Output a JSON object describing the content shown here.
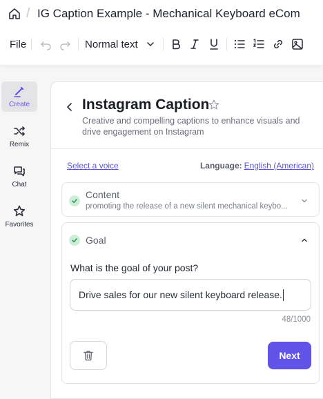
{
  "header": {
    "doc_title": "IG Caption Example - Mechanical Keyboard eCom",
    "home_icon": "home-icon"
  },
  "toolbar": {
    "file_label": "File",
    "text_style": "Normal text",
    "icons": [
      "undo-icon",
      "redo-icon",
      "chevron-down-icon",
      "bold-icon",
      "italic-icon",
      "underline-icon",
      "bullet-list-icon",
      "numbered-list-icon",
      "link-icon",
      "image-icon"
    ]
  },
  "sidebar": {
    "items": [
      {
        "label": "Create",
        "icon": "pen-icon",
        "active": true
      },
      {
        "label": "Remix",
        "icon": "shuffle-icon",
        "active": false
      },
      {
        "label": "Chat",
        "icon": "chat-icon",
        "active": false
      },
      {
        "label": "Favorites",
        "icon": "star-icon",
        "active": false
      }
    ]
  },
  "panel": {
    "title": "Instagram Caption",
    "description": "Creative and compelling captions to enhance visuals and drive engagement on Instagram",
    "voice_link": "Select a voice",
    "language_label": "Language:",
    "language_value": "English (American)"
  },
  "content_step": {
    "title": "Content",
    "summary": "promoting the release of a new silent mechanical keybo..."
  },
  "goal_step": {
    "title": "Goal",
    "question": "What is the goal of your post?",
    "input_value": "Drive sales for our new silent keyboard release.",
    "char_count": "48/1000",
    "next_label": "Next"
  },
  "colors": {
    "accent": "#6152e8",
    "check_bg": "#cdeed6",
    "check_mark": "#2f9a56"
  }
}
